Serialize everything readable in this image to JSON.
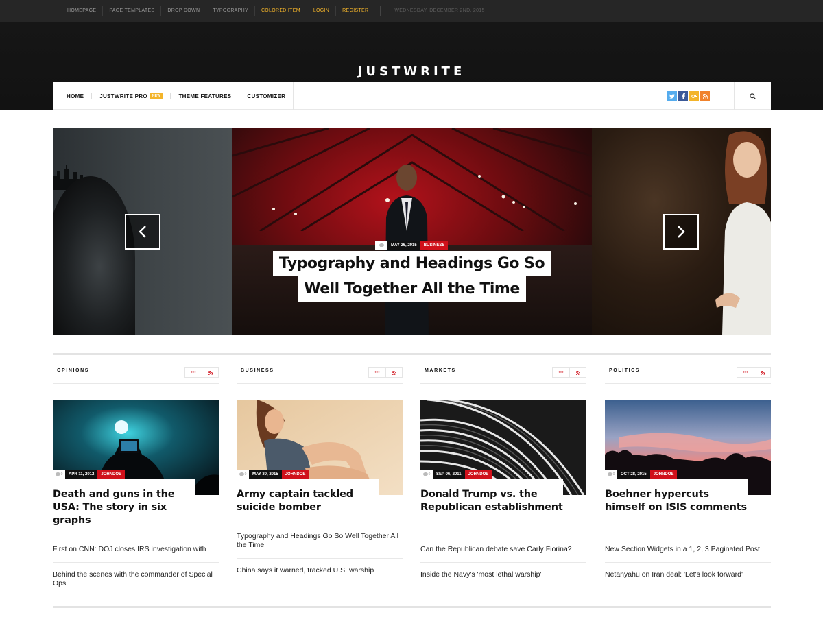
{
  "topbar": {
    "links": [
      "HOMEPAGE",
      "PAGE TEMPLATES",
      "DROP DOWN",
      "TYPOGRAPHY",
      "COLORED ITEM",
      "LOGIN",
      "REGISTER"
    ],
    "date": "WEDNESDAY, DECEMBER 2ND, 2015"
  },
  "header": {
    "logo": "JUSTWRITE"
  },
  "nav": {
    "home": "HOME",
    "pro": "JUSTWRITE PRO",
    "new_badge": "NEW",
    "features": "THEME FEATURES",
    "customizer": "CUSTOMIZER",
    "social": [
      "twitter-icon",
      "facebook-icon",
      "google-plus-icon",
      "rss-icon"
    ]
  },
  "slider": {
    "date": "MAY 26, 2015",
    "category": "BUSINESS",
    "title_line1": "Typography and Headings Go So",
    "title_line2": "Well Together All the Time"
  },
  "columns": [
    {
      "title": "OPINIONS",
      "comments": "0",
      "date": "APR 11, 2012",
      "author": "JOHNDOE",
      "headline": "Death and guns in the USA: The story in six graphs",
      "links": [
        "First on CNN: DOJ closes IRS investigation with",
        "Behind the scenes with the commander of Special Ops"
      ]
    },
    {
      "title": "BUSINESS",
      "comments": "0",
      "date": "MAY 30, 2015",
      "author": "JOHNDOE",
      "headline": "Army captain tackled suicide bomber",
      "links": [
        "Typography and Headings Go So Well Together All the Time",
        "China says it warned, tracked U.S. warship"
      ]
    },
    {
      "title": "MARKETS",
      "comments": "0",
      "date": "SEP 06, 2011",
      "author": "JOHNDOE",
      "headline": "Donald Trump vs. the Republican establishment",
      "links": [
        "Can the Republican debate save Carly Fiorina?",
        "Inside the Navy's 'most lethal warship'"
      ]
    },
    {
      "title": "POLITICS",
      "comments": "0",
      "date": "OCT 28, 2015",
      "author": "JOHNDOE",
      "headline": "Boehner hypercuts himself on ISIS comments",
      "links": [
        "New Section Widgets in a 1, 2, 3 Paginated Post",
        "Netanyahu on Iran deal: 'Let's look forward'"
      ]
    }
  ],
  "colors": {
    "accent_red": "#d0111b",
    "accent_yellow": "#f3b42a",
    "twitter": "#55acee",
    "facebook": "#3b5998",
    "google": "#f3b42a",
    "rss": "#f0822c"
  }
}
